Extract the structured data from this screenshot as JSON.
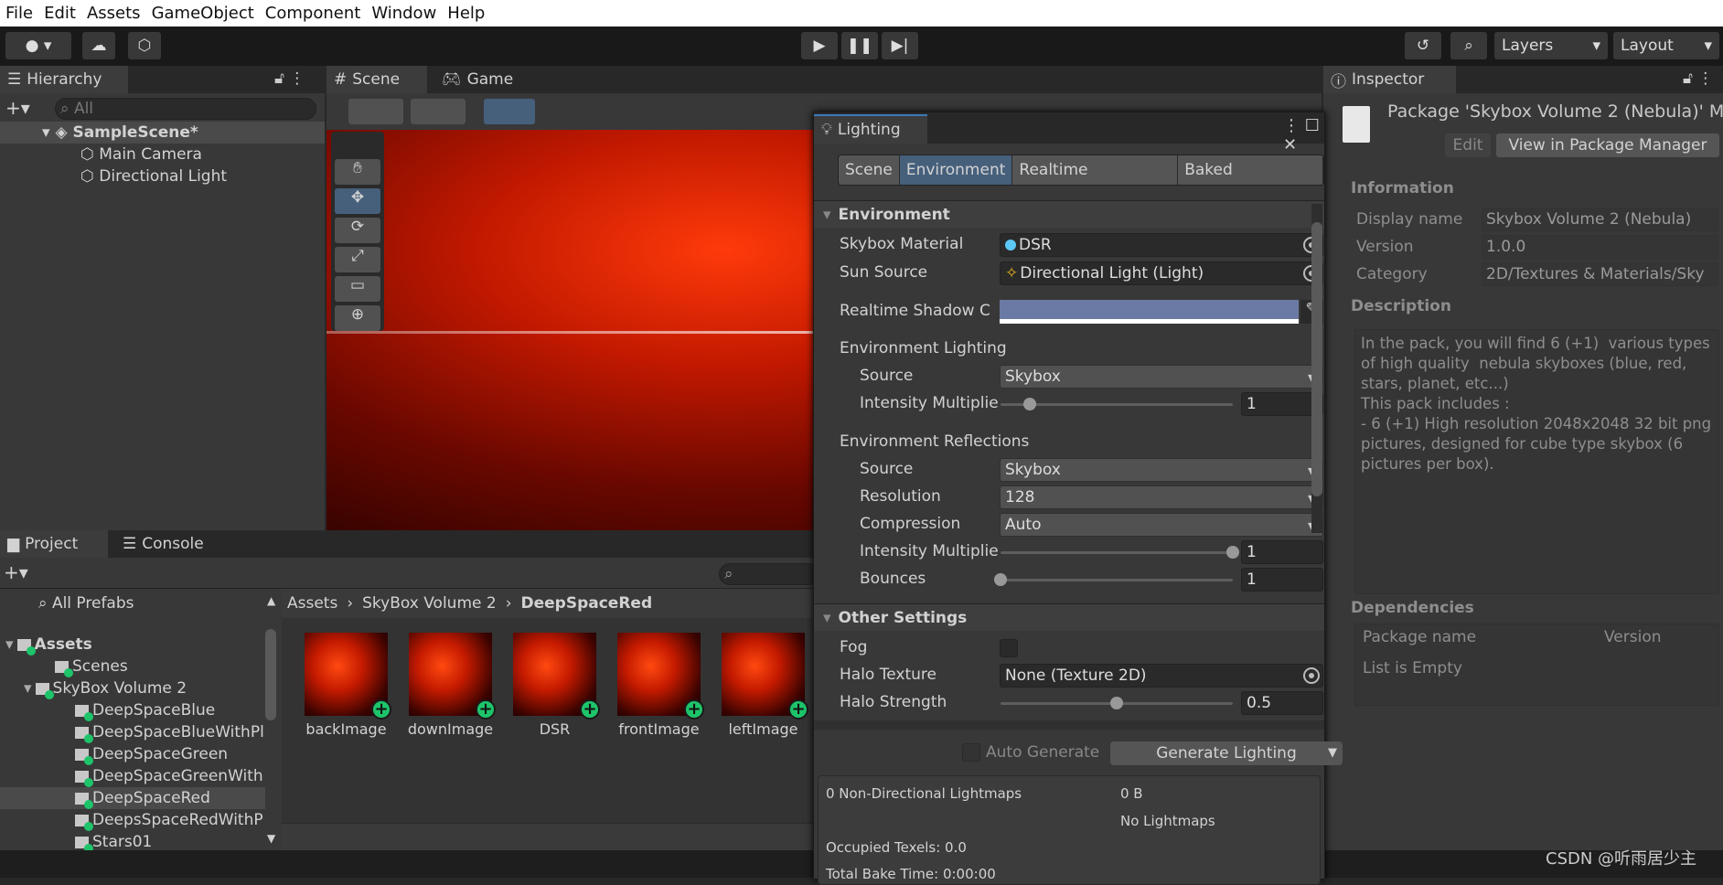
{
  "menu": [
    "File",
    "Edit",
    "Assets",
    "GameObject",
    "Component",
    "Window",
    "Help"
  ],
  "toolbar": {
    "layers": "Layers",
    "layout": "Layout",
    "play_icon": "play-icon",
    "pause_icon": "pause-icon",
    "step_icon": "step-icon"
  },
  "hierarchy": {
    "tab": "Hierarchy",
    "search_placeholder": "All",
    "scene": "SampleScene*",
    "items": [
      "Main Camera",
      "Directional Light"
    ]
  },
  "scene": {
    "tabs": [
      "Scene",
      "Game"
    ]
  },
  "lighting": {
    "title": "Lighting",
    "tabs": [
      "Scene",
      "Environment",
      "Realtime Lightmaps",
      "Baked Lightmaps"
    ],
    "active_tab": "Environment",
    "environment_header": "Environment",
    "skybox_material": {
      "label": "Skybox Material",
      "value": "DSR"
    },
    "sun_source": {
      "label": "Sun Source",
      "value": "Directional Light (Light)"
    },
    "shadow_color": {
      "label": "Realtime Shadow C",
      "color": "#6a7aa4"
    },
    "env_lighting": {
      "header": "Environment Lighting",
      "source_label": "Source",
      "source": "Skybox",
      "intensity_label": "Intensity Multiplie",
      "intensity": "1",
      "intensity_range": [
        0,
        8
      ]
    },
    "env_reflections": {
      "header": "Environment Reflections",
      "source_label": "Source",
      "source": "Skybox",
      "resolution_label": "Resolution",
      "resolution": "128",
      "compression_label": "Compression",
      "compression": "Auto",
      "intensity_label": "Intensity Multiplie",
      "intensity": "1",
      "intensity_range": [
        0,
        1
      ],
      "bounces_label": "Bounces",
      "bounces": "1",
      "bounces_range": [
        1,
        5
      ]
    },
    "other_header": "Other Settings",
    "fog_label": "Fog",
    "fog": false,
    "halo_texture": {
      "label": "Halo Texture",
      "value": "None (Texture 2D)"
    },
    "halo_strength": {
      "label": "Halo Strength",
      "value": "0.5",
      "range": [
        0,
        1
      ]
    },
    "auto_generate": "Auto Generate",
    "generate": "Generate Lighting",
    "stats": {
      "lightmaps": "0 Non-Directional Lightmaps",
      "size": "0 B",
      "no_lightmaps": "No Lightmaps",
      "texels": "Occupied Texels: 0.0",
      "bake_time": "Total Bake Time: 0:00:00"
    }
  },
  "inspector": {
    "tab": "Inspector",
    "title": "Package 'Skybox Volume 2 (Nebula)' M",
    "edit": "Edit",
    "view": "View in Package Manager",
    "information": "Information",
    "rows": [
      {
        "label": "Display name",
        "value": "Skybox Volume 2 (Nebula)"
      },
      {
        "label": "Version",
        "value": "1.0.0"
      },
      {
        "label": "Category",
        "value": "2D/Textures & Materials/Sky"
      }
    ],
    "description_header": "Description",
    "description": "In the pack, you will find 6 (+1)  various types of high quality  nebula skyboxes (blue, red, stars, planet, etc...)\nThis pack includes :\n- 6 (+1) High resolution 2048x2048 32 bit png pictures, designed for cube type skybox (6 pictures per box).",
    "dependencies": "Dependencies",
    "dep_cols": [
      "Package name",
      "Version"
    ],
    "dep_empty": "List is Empty"
  },
  "project": {
    "tabs": [
      "Project",
      "Console"
    ],
    "all_prefabs": "All Prefabs",
    "tree": [
      {
        "label": "Assets",
        "level": 0
      },
      {
        "label": "Scenes",
        "level": 1
      },
      {
        "label": "SkyBox Volume 2",
        "level": 1
      },
      {
        "label": "DeepSpaceBlue",
        "level": 2
      },
      {
        "label": "DeepSpaceBlueWithPl",
        "level": 2
      },
      {
        "label": "DeepSpaceGreen",
        "level": 2
      },
      {
        "label": "DeepSpaceGreenWith",
        "level": 2
      },
      {
        "label": "DeepSpaceRed",
        "level": 2,
        "selected": true
      },
      {
        "label": "DeepsSpaceRedWithP",
        "level": 2
      },
      {
        "label": "Stars01",
        "level": 2
      }
    ],
    "breadcrumb": [
      "Assets",
      "SkyBox Volume 2",
      "DeepSpaceRed"
    ],
    "assets": [
      "backImage",
      "downImage",
      "DSR",
      "frontImage",
      "leftImage"
    ]
  },
  "watermark": "CSDN @听雨居少主"
}
